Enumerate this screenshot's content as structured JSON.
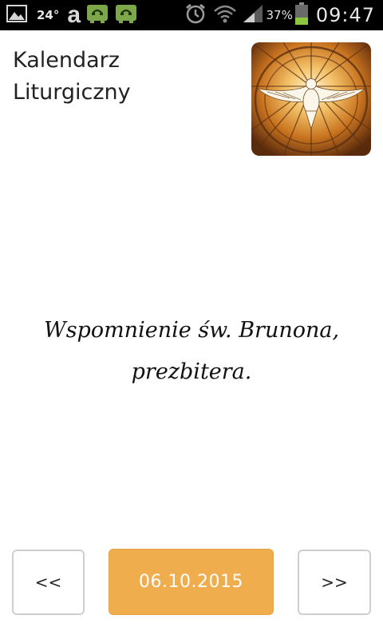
{
  "status_bar": {
    "icons": [
      "gallery-icon",
      "amazon-icon",
      "phone-icon",
      "phone-icon",
      "alarm-icon",
      "wifi-icon",
      "signal-icon",
      "battery-icon"
    ],
    "temperature": "24°",
    "amazon_letter": "a",
    "battery_percent": "37%",
    "battery_level": 0.37,
    "battery_color": "#8dc63f",
    "time": "09:47"
  },
  "header": {
    "title": "Kalendarz Liturgiczny",
    "logo_icon": "holy-spirit-dove-icon"
  },
  "main": {
    "feast": "Wspomnienie św. Brunona, prezbitera."
  },
  "navigation": {
    "prev_label": "<<",
    "date_label": "06.10.2015",
    "next_label": ">>",
    "date_button_color": "#f0ad4e"
  }
}
